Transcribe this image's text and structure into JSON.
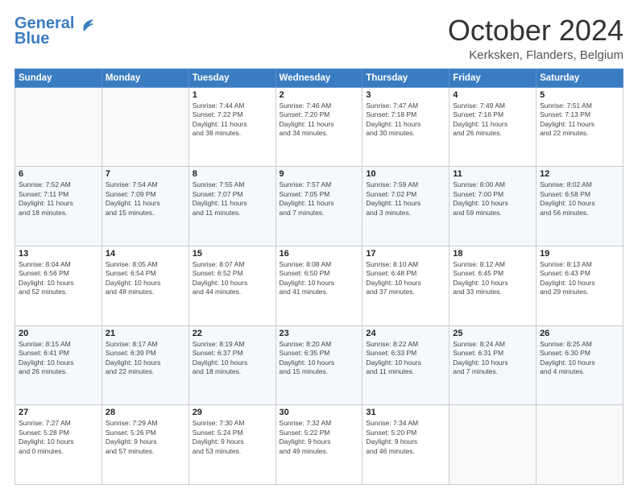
{
  "header": {
    "logo_line1": "General",
    "logo_line2": "Blue",
    "month_title": "October 2024",
    "location": "Kerksken, Flanders, Belgium"
  },
  "weekdays": [
    "Sunday",
    "Monday",
    "Tuesday",
    "Wednesday",
    "Thursday",
    "Friday",
    "Saturday"
  ],
  "weeks": [
    [
      {
        "day": "",
        "info": ""
      },
      {
        "day": "",
        "info": ""
      },
      {
        "day": "1",
        "info": "Sunrise: 7:44 AM\nSunset: 7:22 PM\nDaylight: 11 hours\nand 38 minutes."
      },
      {
        "day": "2",
        "info": "Sunrise: 7:46 AM\nSunset: 7:20 PM\nDaylight: 11 hours\nand 34 minutes."
      },
      {
        "day": "3",
        "info": "Sunrise: 7:47 AM\nSunset: 7:18 PM\nDaylight: 11 hours\nand 30 minutes."
      },
      {
        "day": "4",
        "info": "Sunrise: 7:49 AM\nSunset: 7:16 PM\nDaylight: 11 hours\nand 26 minutes."
      },
      {
        "day": "5",
        "info": "Sunrise: 7:51 AM\nSunset: 7:13 PM\nDaylight: 11 hours\nand 22 minutes."
      }
    ],
    [
      {
        "day": "6",
        "info": "Sunrise: 7:52 AM\nSunset: 7:11 PM\nDaylight: 11 hours\nand 18 minutes."
      },
      {
        "day": "7",
        "info": "Sunrise: 7:54 AM\nSunset: 7:09 PM\nDaylight: 11 hours\nand 15 minutes."
      },
      {
        "day": "8",
        "info": "Sunrise: 7:55 AM\nSunset: 7:07 PM\nDaylight: 11 hours\nand 11 minutes."
      },
      {
        "day": "9",
        "info": "Sunrise: 7:57 AM\nSunset: 7:05 PM\nDaylight: 11 hours\nand 7 minutes."
      },
      {
        "day": "10",
        "info": "Sunrise: 7:59 AM\nSunset: 7:02 PM\nDaylight: 11 hours\nand 3 minutes."
      },
      {
        "day": "11",
        "info": "Sunrise: 8:00 AM\nSunset: 7:00 PM\nDaylight: 10 hours\nand 59 minutes."
      },
      {
        "day": "12",
        "info": "Sunrise: 8:02 AM\nSunset: 6:58 PM\nDaylight: 10 hours\nand 56 minutes."
      }
    ],
    [
      {
        "day": "13",
        "info": "Sunrise: 8:04 AM\nSunset: 6:56 PM\nDaylight: 10 hours\nand 52 minutes."
      },
      {
        "day": "14",
        "info": "Sunrise: 8:05 AM\nSunset: 6:54 PM\nDaylight: 10 hours\nand 48 minutes."
      },
      {
        "day": "15",
        "info": "Sunrise: 8:07 AM\nSunset: 6:52 PM\nDaylight: 10 hours\nand 44 minutes."
      },
      {
        "day": "16",
        "info": "Sunrise: 8:08 AM\nSunset: 6:50 PM\nDaylight: 10 hours\nand 41 minutes."
      },
      {
        "day": "17",
        "info": "Sunrise: 8:10 AM\nSunset: 6:48 PM\nDaylight: 10 hours\nand 37 minutes."
      },
      {
        "day": "18",
        "info": "Sunrise: 8:12 AM\nSunset: 6:45 PM\nDaylight: 10 hours\nand 33 minutes."
      },
      {
        "day": "19",
        "info": "Sunrise: 8:13 AM\nSunset: 6:43 PM\nDaylight: 10 hours\nand 29 minutes."
      }
    ],
    [
      {
        "day": "20",
        "info": "Sunrise: 8:15 AM\nSunset: 6:41 PM\nDaylight: 10 hours\nand 26 minutes."
      },
      {
        "day": "21",
        "info": "Sunrise: 8:17 AM\nSunset: 6:39 PM\nDaylight: 10 hours\nand 22 minutes."
      },
      {
        "day": "22",
        "info": "Sunrise: 8:19 AM\nSunset: 6:37 PM\nDaylight: 10 hours\nand 18 minutes."
      },
      {
        "day": "23",
        "info": "Sunrise: 8:20 AM\nSunset: 6:35 PM\nDaylight: 10 hours\nand 15 minutes."
      },
      {
        "day": "24",
        "info": "Sunrise: 8:22 AM\nSunset: 6:33 PM\nDaylight: 10 hours\nand 11 minutes."
      },
      {
        "day": "25",
        "info": "Sunrise: 8:24 AM\nSunset: 6:31 PM\nDaylight: 10 hours\nand 7 minutes."
      },
      {
        "day": "26",
        "info": "Sunrise: 8:25 AM\nSunset: 6:30 PM\nDaylight: 10 hours\nand 4 minutes."
      }
    ],
    [
      {
        "day": "27",
        "info": "Sunrise: 7:27 AM\nSunset: 5:28 PM\nDaylight: 10 hours\nand 0 minutes."
      },
      {
        "day": "28",
        "info": "Sunrise: 7:29 AM\nSunset: 5:26 PM\nDaylight: 9 hours\nand 57 minutes."
      },
      {
        "day": "29",
        "info": "Sunrise: 7:30 AM\nSunset: 5:24 PM\nDaylight: 9 hours\nand 53 minutes."
      },
      {
        "day": "30",
        "info": "Sunrise: 7:32 AM\nSunset: 5:22 PM\nDaylight: 9 hours\nand 49 minutes."
      },
      {
        "day": "31",
        "info": "Sunrise: 7:34 AM\nSunset: 5:20 PM\nDaylight: 9 hours\nand 46 minutes."
      },
      {
        "day": "",
        "info": ""
      },
      {
        "day": "",
        "info": ""
      }
    ]
  ]
}
